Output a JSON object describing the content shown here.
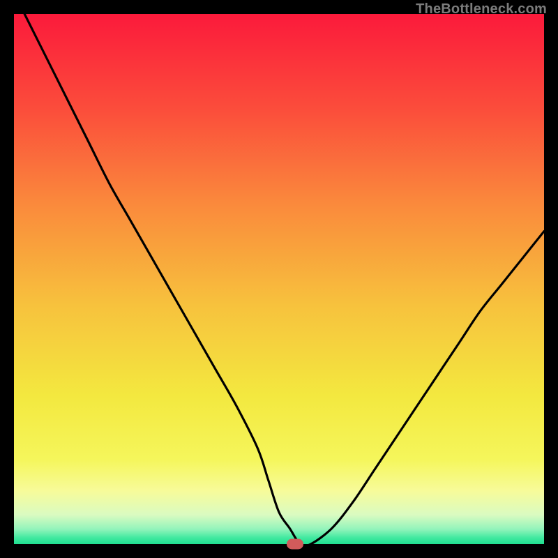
{
  "watermark": {
    "text": "TheBottleneck.com"
  },
  "chart_data": {
    "type": "line",
    "title": "",
    "xlabel": "",
    "ylabel": "",
    "xlim": [
      0,
      100
    ],
    "ylim": [
      0,
      100
    ],
    "grid": false,
    "series": [
      {
        "name": "bottleneck-curve",
        "x": [
          2,
          6,
          10,
          14,
          18,
          22,
          26,
          30,
          34,
          38,
          42,
          46,
          48,
          50,
          52,
          54,
          56,
          60,
          64,
          68,
          72,
          76,
          80,
          84,
          88,
          92,
          96,
          100
        ],
        "values": [
          100,
          92,
          84,
          76,
          68,
          61,
          54,
          47,
          40,
          33,
          26,
          18,
          12,
          6,
          3,
          0,
          0,
          3,
          8,
          14,
          20,
          26,
          32,
          38,
          44,
          49,
          54,
          59
        ]
      }
    ],
    "marker": {
      "x": 53,
      "y": 0,
      "color": "#d15b5b"
    },
    "background_gradient": {
      "stops": [
        {
          "offset": 0.0,
          "color": "#fb1a3b"
        },
        {
          "offset": 0.18,
          "color": "#fb4d3b"
        },
        {
          "offset": 0.36,
          "color": "#fa8a3c"
        },
        {
          "offset": 0.55,
          "color": "#f7c23d"
        },
        {
          "offset": 0.72,
          "color": "#f3e83f"
        },
        {
          "offset": 0.84,
          "color": "#f5f65b"
        },
        {
          "offset": 0.9,
          "color": "#f7fb9a"
        },
        {
          "offset": 0.945,
          "color": "#dafbc1"
        },
        {
          "offset": 0.972,
          "color": "#92f4bb"
        },
        {
          "offset": 0.988,
          "color": "#42e9a0"
        },
        {
          "offset": 1.0,
          "color": "#1fe090"
        }
      ]
    }
  }
}
